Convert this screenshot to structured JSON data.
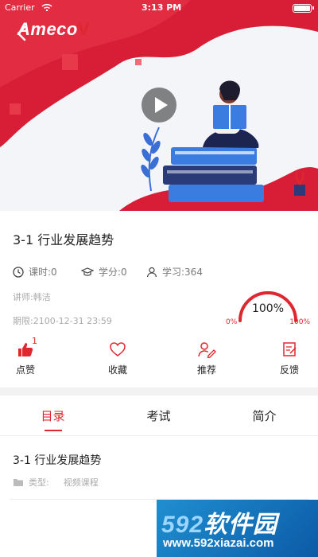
{
  "status_bar": {
    "carrier": "Carrier",
    "time": "3:13 PM"
  },
  "banner": {
    "logo_text": "Ameco",
    "logo_mark": "V"
  },
  "course": {
    "title": "3-1 行业发展趋势",
    "hours": "课时:0",
    "credits": "学分:0",
    "learners": "学习:364",
    "lecturer": "讲师:韩洁",
    "period": "期限:2100-12-31 23:59"
  },
  "progress": {
    "percent_label": "100%",
    "min_label": "0%",
    "max_label": "100%",
    "value": 1.0,
    "color": "#e0262e"
  },
  "actions": {
    "like": {
      "label": "点赞",
      "count": "1"
    },
    "favorite": {
      "label": "收藏"
    },
    "recommend": {
      "label": "推荐"
    },
    "feedback": {
      "label": "反馈"
    }
  },
  "tabs": [
    {
      "label": "目录",
      "active": true
    },
    {
      "label": "考试",
      "active": false
    },
    {
      "label": "简介",
      "active": false
    }
  ],
  "catalog": {
    "items": [
      {
        "title": "3-1 行业发展趋势",
        "type_label": "类型:",
        "type_value": "视频课程"
      }
    ]
  },
  "watermark": {
    "brand_num": "592",
    "brand_text": "软件园",
    "url": "www.592xiazai.com"
  },
  "colors": {
    "accent": "#e0262e",
    "text": "#222222",
    "muted": "#aaaaaa"
  }
}
